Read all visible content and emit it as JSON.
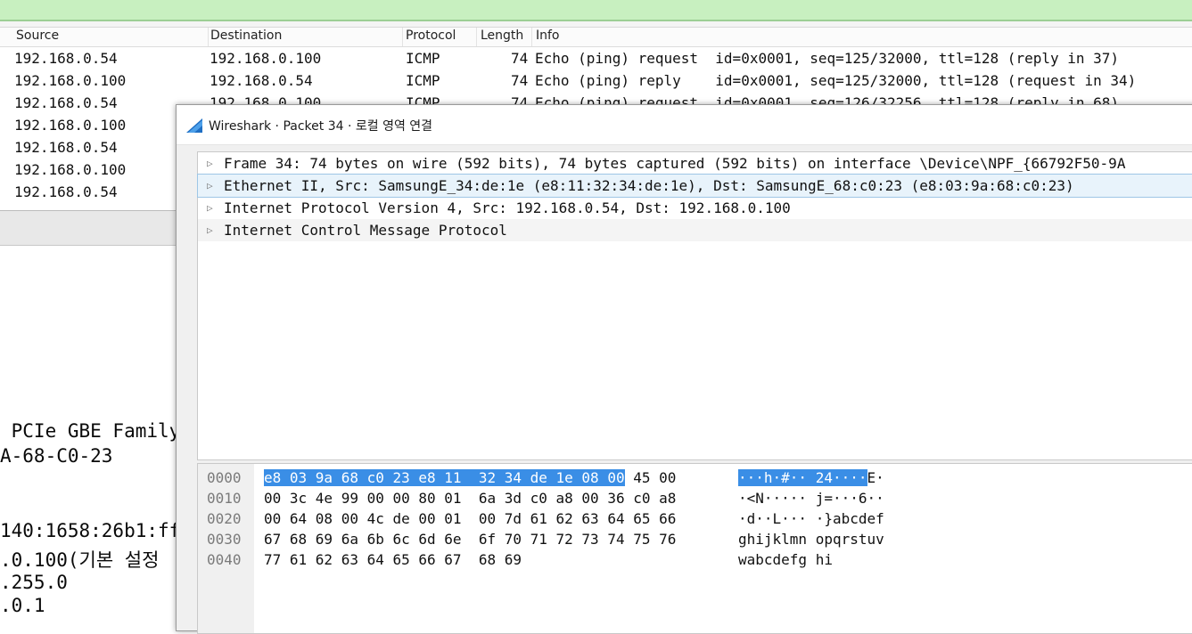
{
  "packet_list": {
    "columns": [
      "Source",
      "Destination",
      "Protocol",
      "Length",
      "Info"
    ],
    "rows": [
      {
        "src": "192.168.0.54",
        "dst": "192.168.0.100",
        "proto": "ICMP",
        "len": "74",
        "info": "Echo (ping) request  id=0x0001, seq=125/32000, ttl=128 (reply in 37)"
      },
      {
        "src": "192.168.0.100",
        "dst": "192.168.0.54",
        "proto": "ICMP",
        "len": "74",
        "info": "Echo (ping) reply    id=0x0001, seq=125/32000, ttl=128 (request in 34)"
      },
      {
        "src": "192.168.0.54",
        "dst": "192.168.0.100",
        "proto": "ICMP",
        "len": "74",
        "info": "Echo (ping) request  id=0x0001, seq=126/32256, ttl=128 (reply in 68)"
      },
      {
        "src": "192.168.0.100",
        "dst": "",
        "proto": "",
        "len": "",
        "info": ""
      },
      {
        "src": "192.168.0.54",
        "dst": "",
        "proto": "",
        "len": "",
        "info": ""
      },
      {
        "src": "192.168.0.100",
        "dst": "",
        "proto": "",
        "len": "",
        "info": ""
      },
      {
        "src": "192.168.0.54",
        "dst": "",
        "proto": "",
        "len": "",
        "info": ""
      }
    ]
  },
  "background_text": {
    "line1": " PCIe GBE Family",
    "line2": "A-68-C0-23",
    "line3": "140:1658:26b1:ff",
    "line4": ".0.100(기본 설정",
    "line5": ".255.0",
    "line6": ".0.1"
  },
  "dialog": {
    "title": "Wireshark · Packet 34 · 로컬 영역 연결",
    "tree": [
      "Frame 34: 74 bytes on wire (592 bits), 74 bytes captured (592 bits) on interface \\Device\\NPF_{66792F50-9A",
      "Ethernet II, Src: SamsungE_34:de:1e (e8:11:32:34:de:1e), Dst: SamsungE_68:c0:23 (e8:03:9a:68:c0:23)",
      "Internet Protocol Version 4, Src: 192.168.0.54, Dst: 192.168.0.100",
      "Internet Control Message Protocol"
    ],
    "hex": [
      {
        "offset": "0000",
        "bytes_hl": "e8 03 9a 68 c0 23 e8 11  32 34 de 1e 08 00",
        "bytes_rest": " 45 00",
        "ascii_hl": "···h·#·· 24····",
        "ascii_rest": "E·"
      },
      {
        "offset": "0010",
        "bytes_hl": "",
        "bytes_rest": "00 3c 4e 99 00 00 80 01  6a 3d c0 a8 00 36 c0 a8",
        "ascii_hl": "",
        "ascii_rest": "·<N····· j=···6··"
      },
      {
        "offset": "0020",
        "bytes_hl": "",
        "bytes_rest": "00 64 08 00 4c de 00 01  00 7d 61 62 63 64 65 66",
        "ascii_hl": "",
        "ascii_rest": "·d··L··· ·}abcdef"
      },
      {
        "offset": "0030",
        "bytes_hl": "",
        "bytes_rest": "67 68 69 6a 6b 6c 6d 6e  6f 70 71 72 73 74 75 76",
        "ascii_hl": "",
        "ascii_rest": "ghijklmn opqrstuv"
      },
      {
        "offset": "0040",
        "bytes_hl": "",
        "bytes_rest": "77 61 62 63 64 65 66 67  68 69",
        "ascii_hl": "",
        "ascii_rest": "wabcdefg hi"
      }
    ]
  },
  "colors": {
    "filter_bar": "#c8f0c0",
    "icmp_row": "#fce0fc",
    "hex_highlight": "#3a8ee6",
    "tree_selected": "#e8f3fb"
  }
}
